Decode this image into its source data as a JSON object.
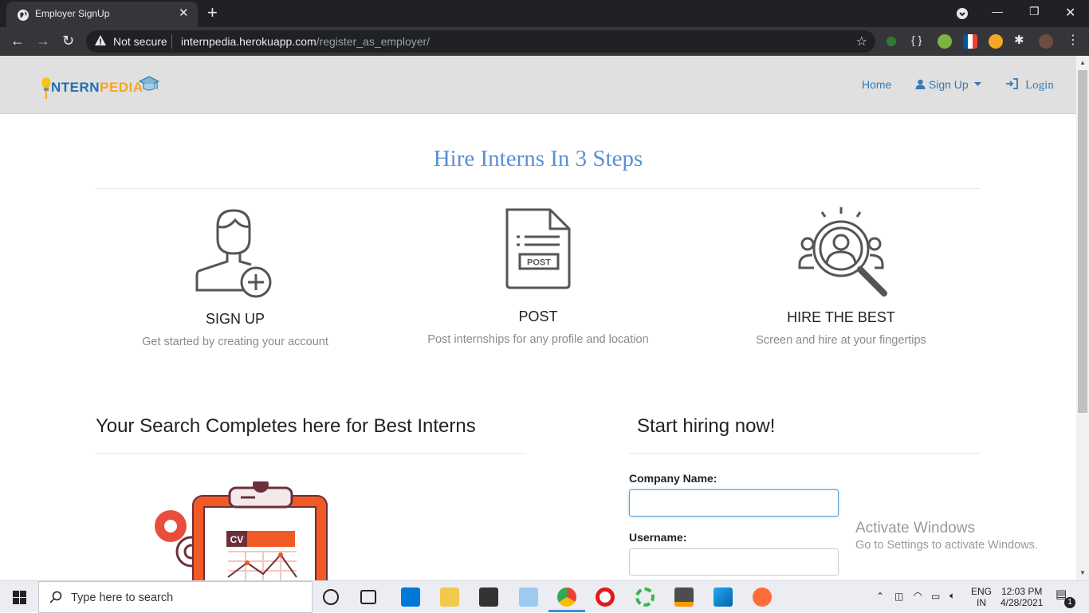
{
  "browser": {
    "tab_title": "Employer SignUp",
    "security_label": "Not secure",
    "url_host": "internpedia.herokuapp.com",
    "url_path": "/register_as_employer/"
  },
  "site": {
    "logo_part1": "NTERN",
    "logo_part2": "PEDIA",
    "logo_letter": "I",
    "nav": {
      "home": "Home",
      "signup": "Sign Up",
      "login": "Login"
    }
  },
  "steps": {
    "title": "Hire Interns In 3 Steps",
    "items": [
      {
        "title": "SIGN UP",
        "subtitle": "Get started by creating your account"
      },
      {
        "title": "POST",
        "subtitle": "Post internships for any profile and location",
        "badge": "POST"
      },
      {
        "title": "HIRE THE BEST",
        "subtitle": "Screen and hire at your fingertips"
      }
    ]
  },
  "left_section": {
    "heading": "Your Search Completes here for Best Interns",
    "cv_label": "CV"
  },
  "form": {
    "heading": "Start hiring now!",
    "company_label": "Company Name:",
    "company_value": "",
    "username_label": "Username:",
    "username_value": ""
  },
  "watermark": {
    "title": "Activate Windows",
    "subtitle": "Go to Settings to activate Windows."
  },
  "taskbar": {
    "search_placeholder": "Type here to search",
    "lang_top": "ENG",
    "lang_bottom": "IN",
    "time": "12:03 PM",
    "date": "4/28/2021",
    "notification_count": "1"
  },
  "colors": {
    "brand_blue": "#337ab7",
    "title_blue": "#5b8fd6",
    "logo_orange": "#f5a623"
  }
}
